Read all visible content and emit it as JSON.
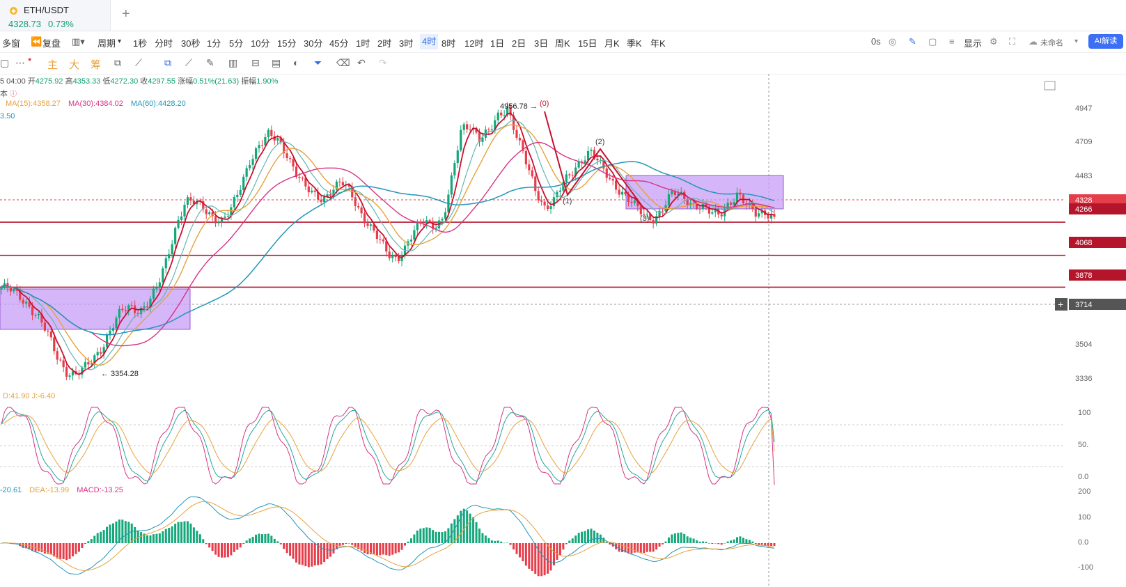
{
  "tab": {
    "coin_icon": "ethereum-coin-icon",
    "symbol": "ETH/USDT",
    "price": "4328.73",
    "change": "0.73%"
  },
  "toolbar": {
    "multi_window": "多窗",
    "replay": "复盘",
    "period": "周期",
    "intervals": [
      "1秒",
      "分时",
      "30秒",
      "1分",
      "5分",
      "10分",
      "15分",
      "30分",
      "45分",
      "1时",
      "2时",
      "3时",
      "4时",
      "8时",
      "12时",
      "1日",
      "2日",
      "3日",
      "周K",
      "15日",
      "月K",
      "季K",
      "年K"
    ],
    "active_interval": "4时",
    "zero_seconds": "0s",
    "display": "显示",
    "unnamed": "未命名",
    "ai": "AI解读"
  },
  "drawbar": {
    "main": "主",
    "big": "大",
    "chip": "筹"
  },
  "info": {
    "time": "5 04:00",
    "open_label": "开",
    "open": "4275.92",
    "high_label": "高",
    "high": "4353.33",
    "low_label": "低",
    "low": "4272.30",
    "close_label": "收",
    "close": "4297.55",
    "chg_label": "涨幅",
    "chg": "0.51%(21.63)",
    "amp_label": "振幅",
    "amp": "1.90%",
    "sub": "本",
    "ma15": "MA(15):4358.27",
    "ma30": "MA(30):4384.02",
    "ma60": "MA(60):4428.20",
    "ma_extra": "3.50",
    "kdj": "D:41.90  J:-6.40",
    "macd_dif": "-20.61",
    "macd_dea": "DEA:-13.99",
    "macd_val": "MACD:-13.25"
  },
  "chart_data": {
    "type": "candlestick",
    "title": "",
    "annotations": {
      "high": "4956.78",
      "low": "3354.28",
      "wave_labels": [
        "(0)",
        "(1)",
        "(2)",
        "(3)"
      ]
    },
    "price_axis_labels": [
      "4947",
      "4709",
      "4483",
      "4328",
      "4266",
      "4068",
      "3878",
      "3714",
      "3504",
      "3336"
    ],
    "horizontal_levels": [
      4266,
      4068,
      3878
    ],
    "current_price_line": 4328,
    "kdj_axis_labels": [
      "100",
      "50.",
      "0.0"
    ],
    "macd_axis_labels": [
      "200",
      "100",
      "0.0",
      "-100"
    ],
    "close_path": [
      3880,
      3860,
      3820,
      3770,
      3700,
      3600,
      3470,
      3380,
      3354,
      3390,
      3450,
      3530,
      3640,
      3730,
      3760,
      3740,
      3790,
      3880,
      4050,
      4250,
      4390,
      4380,
      4350,
      4300,
      4270,
      4340,
      4480,
      4640,
      4720,
      4780,
      4760,
      4680,
      4560,
      4470,
      4430,
      4410,
      4460,
      4500,
      4440,
      4330,
      4240,
      4160,
      4080,
      4050,
      4120,
      4220,
      4280,
      4250,
      4280,
      4530,
      4830,
      4850,
      4760,
      4800,
      4900,
      4956,
      4780,
      4620,
      4460,
      4360,
      4390,
      4490,
      4560,
      4640,
      4690,
      4610,
      4530,
      4470,
      4410,
      4350,
      4300,
      4290,
      4360,
      4440,
      4420,
      4380,
      4360,
      4320,
      4310,
      4380,
      4430,
      4360,
      4320,
      4330,
      4297
    ],
    "series": [
      {
        "name": "MA(15)",
        "color": "#e6a23c",
        "value": 4358.27
      },
      {
        "name": "MA(30)",
        "color": "#d63384",
        "value": 4384.02
      },
      {
        "name": "MA(60)",
        "color": "#2196b8",
        "value": 4428.2
      }
    ],
    "colors": {
      "up": "#13a77a",
      "down": "#e53e4b",
      "box": "#c79df5",
      "level": "#b5152b"
    }
  }
}
